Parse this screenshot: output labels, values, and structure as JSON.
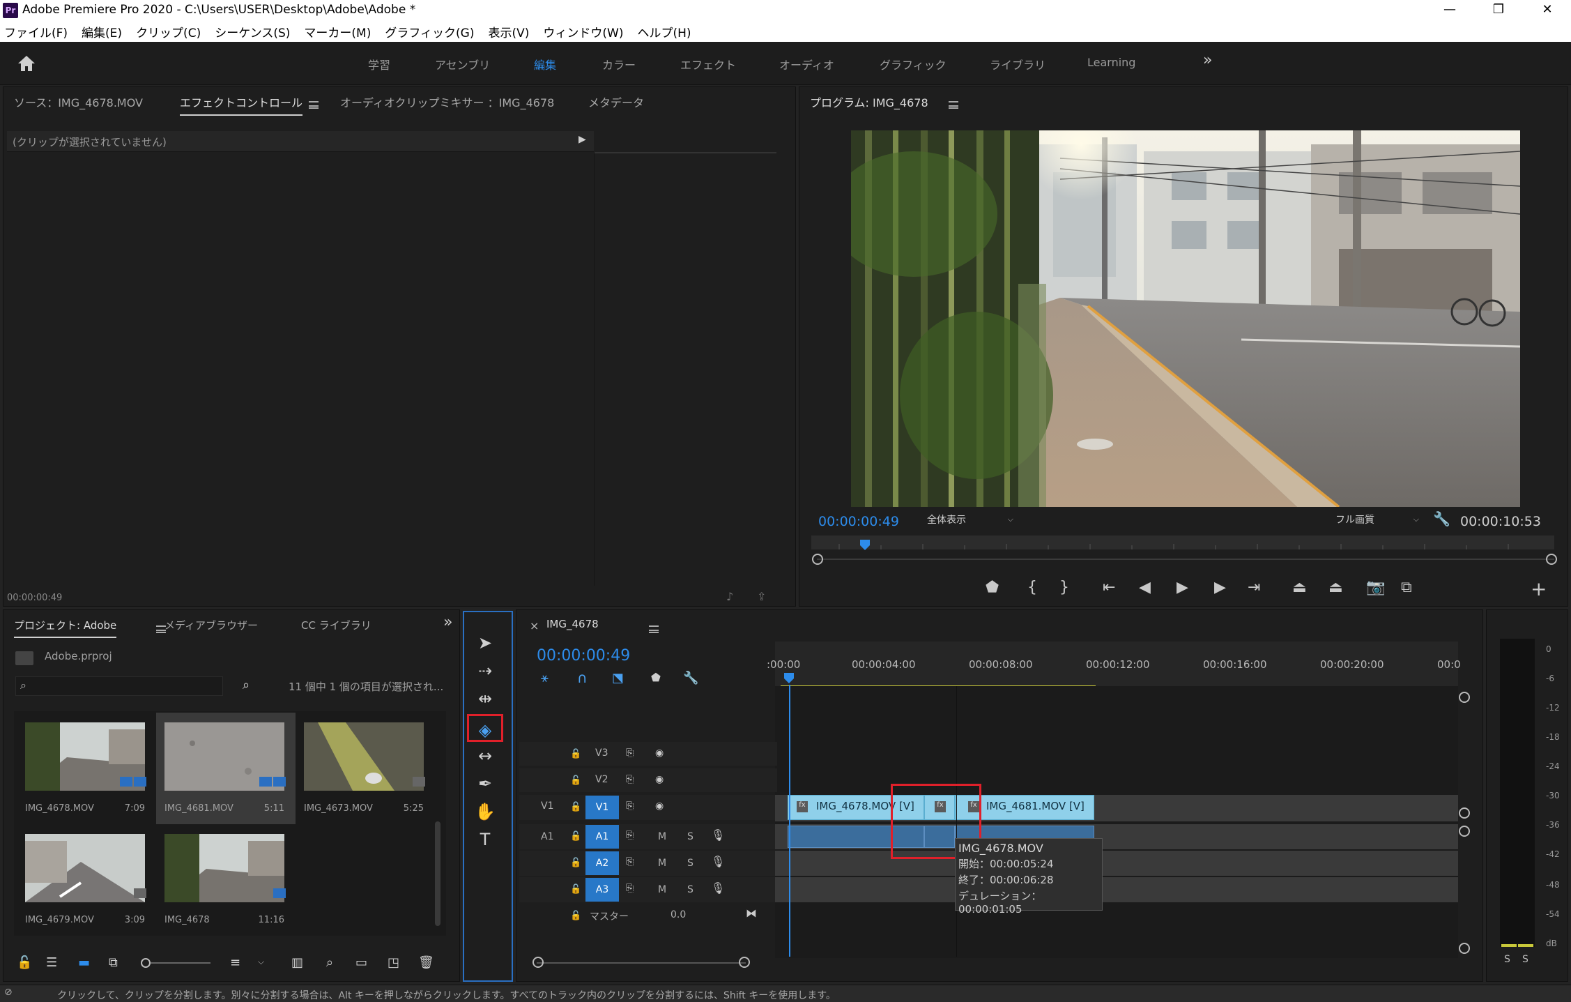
{
  "window": {
    "title": "Adobe Premiere Pro 2020 - C:\\Users\\USER\\Desktop\\Adobe\\Adobe *",
    "logo": "Pr",
    "minimize": "—",
    "restore": "❐",
    "close": "✕"
  },
  "menu": [
    "ファイル(F)",
    "編集(E)",
    "クリップ(C)",
    "シーケンス(S)",
    "マーカー(M)",
    "グラフィック(G)",
    "表示(V)",
    "ウィンドウ(W)",
    "ヘルプ(H)"
  ],
  "workspaces": {
    "items": [
      "学習",
      "アセンブリ",
      "編集",
      "カラー",
      "エフェクト",
      "オーディオ",
      "グラフィック",
      "ライブラリ",
      "Learning"
    ],
    "active": "編集",
    "more": "»"
  },
  "source_panel": {
    "tabs": [
      "ソース：IMG_4678.MOV",
      "エフェクトコントロール",
      "オーディオクリップミキサー ：IMG_4678",
      "メタデータ"
    ],
    "no_clip": "(クリップが選択されていません)",
    "timecode": "00:00:00:49"
  },
  "program": {
    "title": "プログラム: IMG_4678",
    "timecode": "00:00:00:49",
    "zoom": "全体表示",
    "quality": "フル画質",
    "duration": "00:00:10:53",
    "add": "+"
  },
  "project": {
    "tabs": [
      "プロジェクト: Adobe",
      "メディアブラウザー",
      "CC ライブラリ"
    ],
    "more": "»",
    "file": "Adobe.prproj",
    "search_placeholder": "",
    "selection": "11 個中 1 個の項目が選択され...",
    "items": [
      {
        "name": "IMG_4678.MOV",
        "duration": "7:09"
      },
      {
        "name": "IMG_4681.MOV",
        "duration": "5:11"
      },
      {
        "name": "IMG_4673.MOV",
        "duration": "5:25"
      },
      {
        "name": "IMG_4679.MOV",
        "duration": "3:09"
      },
      {
        "name": "IMG_4678",
        "duration": "11:16"
      }
    ]
  },
  "timeline": {
    "tab": "IMG_4678",
    "close": "×",
    "timecode": "00:00:00:49",
    "ruler": [
      ":00:00",
      "00:00:04:00",
      "00:00:08:00",
      "00:00:12:00",
      "00:00:16:00",
      "00:00:20:00",
      "00:0"
    ],
    "tracks": {
      "v3": "V3",
      "v2": "V2",
      "v1": "V1",
      "v1_src": "V1",
      "a1": "A1",
      "a1_src": "A1",
      "a2": "A2",
      "a3": "A3",
      "master": "マスター",
      "master_val": "0.0",
      "m": "M",
      "s": "S"
    },
    "clips": {
      "v1a": "IMG_4678.MOV [V]",
      "v1b": "IMG_4681.MOV [V]",
      "fx": "fx"
    },
    "tooltip": {
      "name": "IMG_4678.MOV",
      "start": "開始：00:00:05:24",
      "end": "終了：00:00:06:28",
      "duration": "デュレーション：00:00:01:05"
    }
  },
  "meter": {
    "labels": [
      "0",
      "-6",
      "-12",
      "-18",
      "-24",
      "-30",
      "-36",
      "-42",
      "-48",
      "-54",
      "dB"
    ],
    "solo_l": "S",
    "solo_r": "S"
  },
  "status": "クリックして、クリップを分割します。別々に分割する場合は、Alt キーを押しながらクリックします。すべてのトラック内のクリップを分割するには、Shift キーを使用します。",
  "colors": {
    "accent": "#2d8ceb",
    "clip_video": "#8fd0ea",
    "highlight": "#e0202a"
  }
}
